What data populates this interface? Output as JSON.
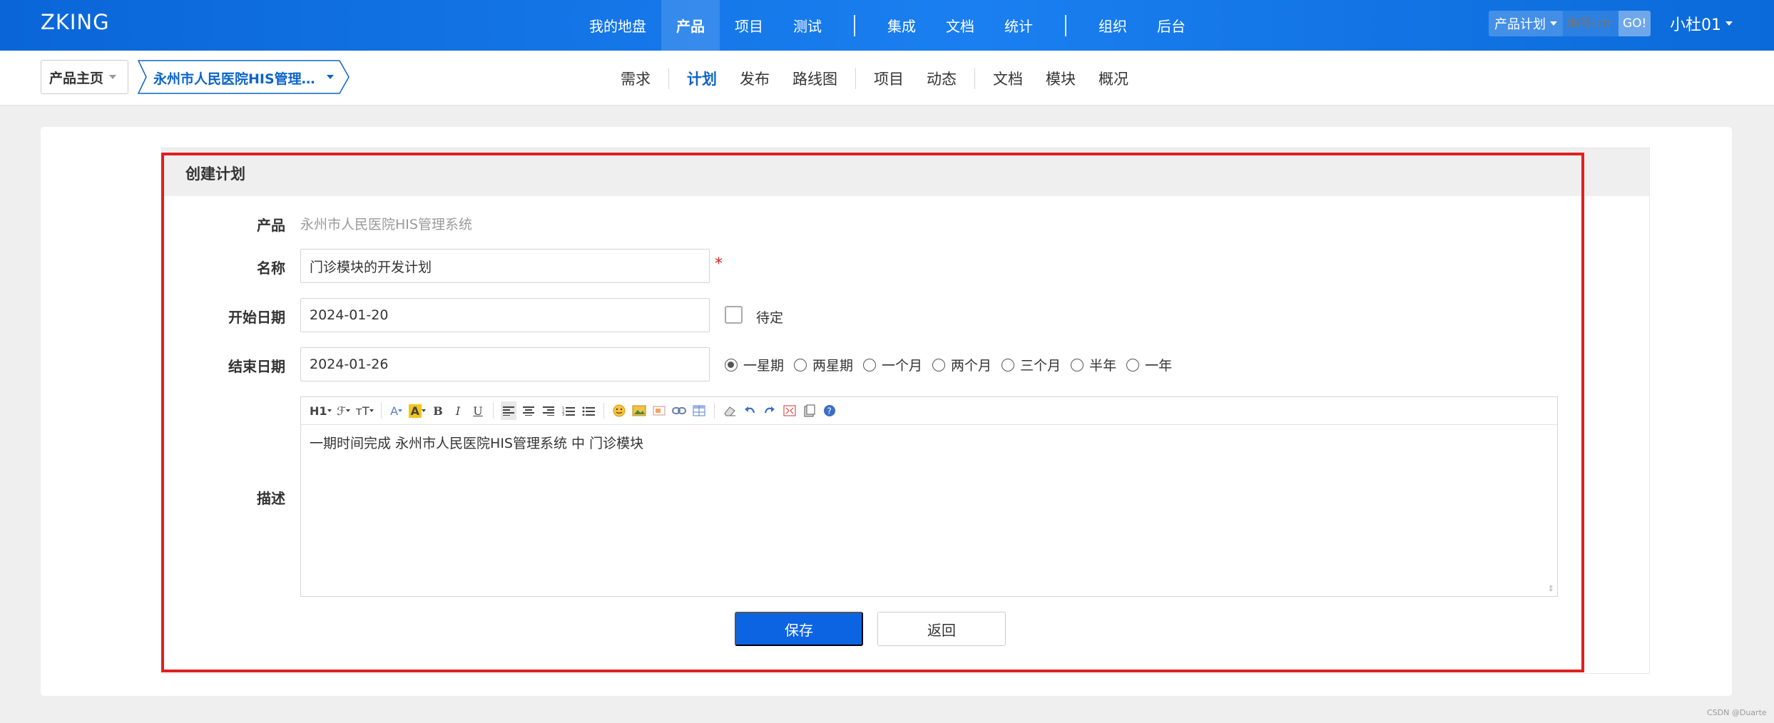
{
  "app": {
    "logo": "ZKING"
  },
  "main_nav": {
    "items": [
      "我的地盘",
      "产品",
      "项目",
      "测试",
      "集成",
      "文档",
      "统计",
      "组织",
      "后台"
    ],
    "active": "产品"
  },
  "search": {
    "type_label": "产品计划",
    "code_placeholder": "编号(ctr",
    "go_label": "GO!"
  },
  "user": {
    "name": "小杜01"
  },
  "breadcrumb": {
    "home": "产品主页",
    "product": "永州市人民医院HIS管理…"
  },
  "sub_nav": {
    "items": [
      "需求",
      "计划",
      "发布",
      "路线图",
      "项目",
      "动态",
      "文档",
      "模块",
      "概况"
    ],
    "active": "计划"
  },
  "form": {
    "title": "创建计划",
    "product_label": "产品",
    "product_value": "永州市人民医院HIS管理系统",
    "name_label": "名称",
    "name_value": "门诊模块的开发计划",
    "required_mark": "*",
    "start_label": "开始日期",
    "start_value": "2024-01-20",
    "pending_label": "待定",
    "pending_checked": false,
    "end_label": "结束日期",
    "end_value": "2024-01-26",
    "durations": [
      "一星期",
      "两星期",
      "一个月",
      "两个月",
      "三个月",
      "半年",
      "一年"
    ],
    "duration_selected": "一星期",
    "desc_label": "描述",
    "desc_value": "一期时间完成 永州市人民医院HIS管理系统 中 门诊模块",
    "save_label": "保存",
    "back_label": "返回"
  },
  "editor_toolbar": {
    "heading": "H1",
    "font_family": "ℱ",
    "font_size": "тT",
    "font_color": "A",
    "highlight": "A",
    "bold": "B",
    "italic": "I",
    "underline": "U"
  },
  "colors": {
    "primary": "#0c64e3",
    "nav_blue": "#1a7ff0",
    "active_text": "#0c64c9",
    "highlight_red": "#e02020"
  },
  "watermark": "CSDN @Duarte"
}
